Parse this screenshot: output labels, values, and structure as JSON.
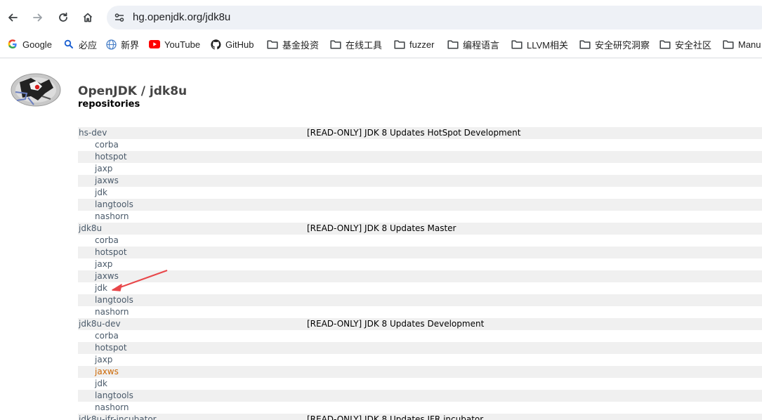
{
  "browser": {
    "url": "hg.openjdk.org/jdk8u",
    "bookmarks": [
      {
        "label": "Google",
        "icon": "google-icon"
      },
      {
        "label": "必应",
        "icon": "search-icon"
      },
      {
        "label": "新界",
        "icon": "globe-icon"
      },
      {
        "label": "YouTube",
        "icon": "youtube-icon"
      },
      {
        "label": "GitHub",
        "icon": "github-icon"
      },
      {
        "label": "基金投资",
        "icon": "folder-icon"
      },
      {
        "label": "在线工具",
        "icon": "folder-icon"
      },
      {
        "label": "fuzzer",
        "icon": "folder-icon"
      },
      {
        "label": "编程语言",
        "icon": "folder-icon"
      },
      {
        "label": "LLVM相关",
        "icon": "folder-icon"
      },
      {
        "label": "安全研究洞察",
        "icon": "folder-icon"
      },
      {
        "label": "安全社区",
        "icon": "folder-icon"
      },
      {
        "label": "Manu",
        "icon": "folder-icon"
      }
    ]
  },
  "page": {
    "title": "OpenJDK / jdk8u",
    "subtitle": "repositories",
    "rows": [
      {
        "name": "hs-dev",
        "desc": "[READ-ONLY] JDK 8 Updates HotSpot Development",
        "child": false
      },
      {
        "name": "corba",
        "desc": "",
        "child": true
      },
      {
        "name": "hotspot",
        "desc": "",
        "child": true
      },
      {
        "name": "jaxp",
        "desc": "",
        "child": true
      },
      {
        "name": "jaxws",
        "desc": "",
        "child": true
      },
      {
        "name": "jdk",
        "desc": "",
        "child": true
      },
      {
        "name": "langtools",
        "desc": "",
        "child": true
      },
      {
        "name": "nashorn",
        "desc": "",
        "child": true
      },
      {
        "name": "jdk8u",
        "desc": "[READ-ONLY] JDK 8 Updates Master",
        "child": false
      },
      {
        "name": "corba",
        "desc": "",
        "child": true
      },
      {
        "name": "hotspot",
        "desc": "",
        "child": true
      },
      {
        "name": "jaxp",
        "desc": "",
        "child": true
      },
      {
        "name": "jaxws",
        "desc": "",
        "child": true
      },
      {
        "name": "jdk",
        "desc": "",
        "child": true
      },
      {
        "name": "langtools",
        "desc": "",
        "child": true
      },
      {
        "name": "nashorn",
        "desc": "",
        "child": true
      },
      {
        "name": "jdk8u-dev",
        "desc": "[READ-ONLY] JDK 8 Updates Development",
        "child": false
      },
      {
        "name": "corba",
        "desc": "",
        "child": true
      },
      {
        "name": "hotspot",
        "desc": "",
        "child": true
      },
      {
        "name": "jaxp",
        "desc": "",
        "child": true
      },
      {
        "name": "jaxws",
        "desc": "",
        "child": true,
        "visited": true
      },
      {
        "name": "jdk",
        "desc": "",
        "child": true
      },
      {
        "name": "langtools",
        "desc": "",
        "child": true
      },
      {
        "name": "nashorn",
        "desc": "",
        "child": true
      },
      {
        "name": "jdk8u-jfr-incubator",
        "desc": "[READ-ONLY] JDK 8 Updates JFR incubator",
        "child": false
      }
    ]
  },
  "colors": {
    "link": "#4a5a6a",
    "visited_link": "#cc6600",
    "row_alt": "#f0f0f0",
    "annotation_arrow": "#e8474a"
  }
}
